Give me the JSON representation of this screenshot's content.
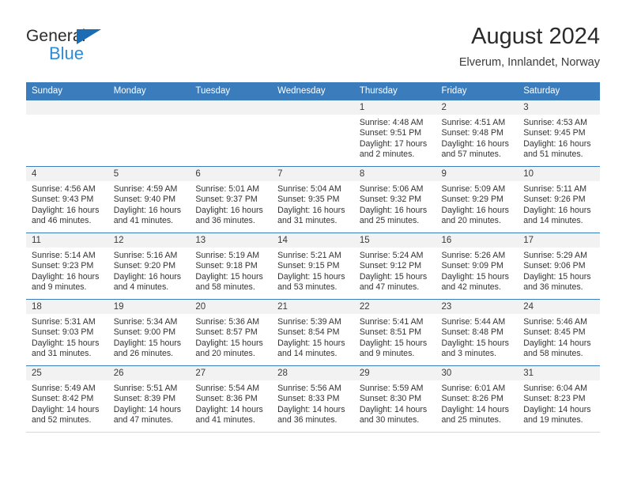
{
  "brand": {
    "name_part1": "General",
    "name_part2": "Blue",
    "triangle_icon": "triangle-icon",
    "accent_dark": "#1b6cb3",
    "accent_light": "#2e8bd6"
  },
  "header": {
    "title": "August 2024",
    "subtitle": "Elverum, Innlandet, Norway"
  },
  "theme": {
    "header_blue": "#3b7cbd",
    "daynum_band": "#f2f2f2",
    "text": "#333333"
  },
  "weekday_headers": [
    "Sunday",
    "Monday",
    "Tuesday",
    "Wednesday",
    "Thursday",
    "Friday",
    "Saturday"
  ],
  "weeks": [
    [
      {
        "day": "",
        "sunrise": "",
        "sunset": "",
        "daylight1": "",
        "daylight2": ""
      },
      {
        "day": "",
        "sunrise": "",
        "sunset": "",
        "daylight1": "",
        "daylight2": ""
      },
      {
        "day": "",
        "sunrise": "",
        "sunset": "",
        "daylight1": "",
        "daylight2": ""
      },
      {
        "day": "",
        "sunrise": "",
        "sunset": "",
        "daylight1": "",
        "daylight2": ""
      },
      {
        "day": "1",
        "sunrise": "Sunrise: 4:48 AM",
        "sunset": "Sunset: 9:51 PM",
        "daylight1": "Daylight: 17 hours",
        "daylight2": "and 2 minutes."
      },
      {
        "day": "2",
        "sunrise": "Sunrise: 4:51 AM",
        "sunset": "Sunset: 9:48 PM",
        "daylight1": "Daylight: 16 hours",
        "daylight2": "and 57 minutes."
      },
      {
        "day": "3",
        "sunrise": "Sunrise: 4:53 AM",
        "sunset": "Sunset: 9:45 PM",
        "daylight1": "Daylight: 16 hours",
        "daylight2": "and 51 minutes."
      }
    ],
    [
      {
        "day": "4",
        "sunrise": "Sunrise: 4:56 AM",
        "sunset": "Sunset: 9:43 PM",
        "daylight1": "Daylight: 16 hours",
        "daylight2": "and 46 minutes."
      },
      {
        "day": "5",
        "sunrise": "Sunrise: 4:59 AM",
        "sunset": "Sunset: 9:40 PM",
        "daylight1": "Daylight: 16 hours",
        "daylight2": "and 41 minutes."
      },
      {
        "day": "6",
        "sunrise": "Sunrise: 5:01 AM",
        "sunset": "Sunset: 9:37 PM",
        "daylight1": "Daylight: 16 hours",
        "daylight2": "and 36 minutes."
      },
      {
        "day": "7",
        "sunrise": "Sunrise: 5:04 AM",
        "sunset": "Sunset: 9:35 PM",
        "daylight1": "Daylight: 16 hours",
        "daylight2": "and 31 minutes."
      },
      {
        "day": "8",
        "sunrise": "Sunrise: 5:06 AM",
        "sunset": "Sunset: 9:32 PM",
        "daylight1": "Daylight: 16 hours",
        "daylight2": "and 25 minutes."
      },
      {
        "day": "9",
        "sunrise": "Sunrise: 5:09 AM",
        "sunset": "Sunset: 9:29 PM",
        "daylight1": "Daylight: 16 hours",
        "daylight2": "and 20 minutes."
      },
      {
        "day": "10",
        "sunrise": "Sunrise: 5:11 AM",
        "sunset": "Sunset: 9:26 PM",
        "daylight1": "Daylight: 16 hours",
        "daylight2": "and 14 minutes."
      }
    ],
    [
      {
        "day": "11",
        "sunrise": "Sunrise: 5:14 AM",
        "sunset": "Sunset: 9:23 PM",
        "daylight1": "Daylight: 16 hours",
        "daylight2": "and 9 minutes."
      },
      {
        "day": "12",
        "sunrise": "Sunrise: 5:16 AM",
        "sunset": "Sunset: 9:20 PM",
        "daylight1": "Daylight: 16 hours",
        "daylight2": "and 4 minutes."
      },
      {
        "day": "13",
        "sunrise": "Sunrise: 5:19 AM",
        "sunset": "Sunset: 9:18 PM",
        "daylight1": "Daylight: 15 hours",
        "daylight2": "and 58 minutes."
      },
      {
        "day": "14",
        "sunrise": "Sunrise: 5:21 AM",
        "sunset": "Sunset: 9:15 PM",
        "daylight1": "Daylight: 15 hours",
        "daylight2": "and 53 minutes."
      },
      {
        "day": "15",
        "sunrise": "Sunrise: 5:24 AM",
        "sunset": "Sunset: 9:12 PM",
        "daylight1": "Daylight: 15 hours",
        "daylight2": "and 47 minutes."
      },
      {
        "day": "16",
        "sunrise": "Sunrise: 5:26 AM",
        "sunset": "Sunset: 9:09 PM",
        "daylight1": "Daylight: 15 hours",
        "daylight2": "and 42 minutes."
      },
      {
        "day": "17",
        "sunrise": "Sunrise: 5:29 AM",
        "sunset": "Sunset: 9:06 PM",
        "daylight1": "Daylight: 15 hours",
        "daylight2": "and 36 minutes."
      }
    ],
    [
      {
        "day": "18",
        "sunrise": "Sunrise: 5:31 AM",
        "sunset": "Sunset: 9:03 PM",
        "daylight1": "Daylight: 15 hours",
        "daylight2": "and 31 minutes."
      },
      {
        "day": "19",
        "sunrise": "Sunrise: 5:34 AM",
        "sunset": "Sunset: 9:00 PM",
        "daylight1": "Daylight: 15 hours",
        "daylight2": "and 26 minutes."
      },
      {
        "day": "20",
        "sunrise": "Sunrise: 5:36 AM",
        "sunset": "Sunset: 8:57 PM",
        "daylight1": "Daylight: 15 hours",
        "daylight2": "and 20 minutes."
      },
      {
        "day": "21",
        "sunrise": "Sunrise: 5:39 AM",
        "sunset": "Sunset: 8:54 PM",
        "daylight1": "Daylight: 15 hours",
        "daylight2": "and 14 minutes."
      },
      {
        "day": "22",
        "sunrise": "Sunrise: 5:41 AM",
        "sunset": "Sunset: 8:51 PM",
        "daylight1": "Daylight: 15 hours",
        "daylight2": "and 9 minutes."
      },
      {
        "day": "23",
        "sunrise": "Sunrise: 5:44 AM",
        "sunset": "Sunset: 8:48 PM",
        "daylight1": "Daylight: 15 hours",
        "daylight2": "and 3 minutes."
      },
      {
        "day": "24",
        "sunrise": "Sunrise: 5:46 AM",
        "sunset": "Sunset: 8:45 PM",
        "daylight1": "Daylight: 14 hours",
        "daylight2": "and 58 minutes."
      }
    ],
    [
      {
        "day": "25",
        "sunrise": "Sunrise: 5:49 AM",
        "sunset": "Sunset: 8:42 PM",
        "daylight1": "Daylight: 14 hours",
        "daylight2": "and 52 minutes."
      },
      {
        "day": "26",
        "sunrise": "Sunrise: 5:51 AM",
        "sunset": "Sunset: 8:39 PM",
        "daylight1": "Daylight: 14 hours",
        "daylight2": "and 47 minutes."
      },
      {
        "day": "27",
        "sunrise": "Sunrise: 5:54 AM",
        "sunset": "Sunset: 8:36 PM",
        "daylight1": "Daylight: 14 hours",
        "daylight2": "and 41 minutes."
      },
      {
        "day": "28",
        "sunrise": "Sunrise: 5:56 AM",
        "sunset": "Sunset: 8:33 PM",
        "daylight1": "Daylight: 14 hours",
        "daylight2": "and 36 minutes."
      },
      {
        "day": "29",
        "sunrise": "Sunrise: 5:59 AM",
        "sunset": "Sunset: 8:30 PM",
        "daylight1": "Daylight: 14 hours",
        "daylight2": "and 30 minutes."
      },
      {
        "day": "30",
        "sunrise": "Sunrise: 6:01 AM",
        "sunset": "Sunset: 8:26 PM",
        "daylight1": "Daylight: 14 hours",
        "daylight2": "and 25 minutes."
      },
      {
        "day": "31",
        "sunrise": "Sunrise: 6:04 AM",
        "sunset": "Sunset: 8:23 PM",
        "daylight1": "Daylight: 14 hours",
        "daylight2": "and 19 minutes."
      }
    ]
  ]
}
